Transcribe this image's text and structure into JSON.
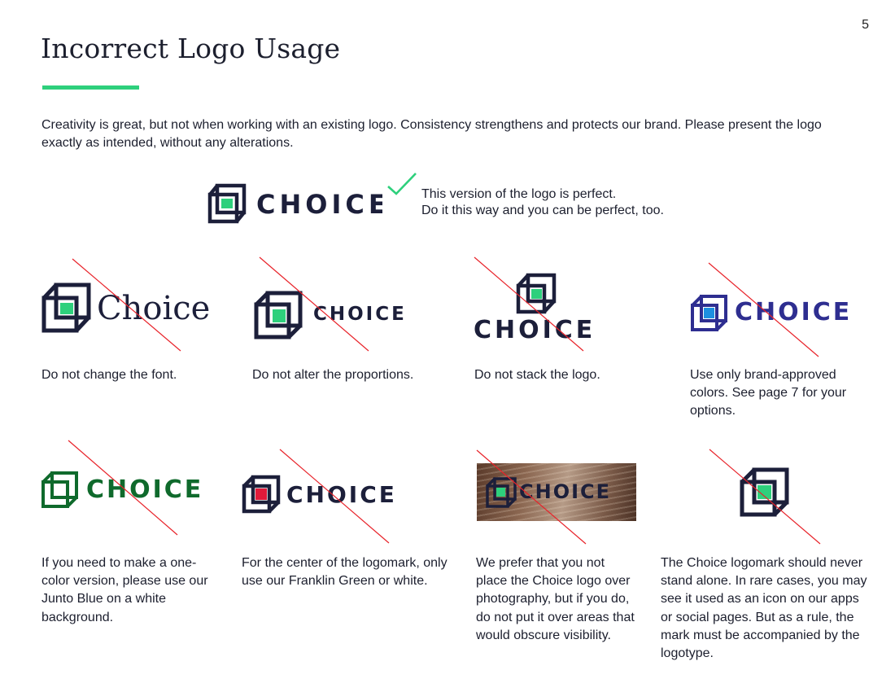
{
  "page": {
    "number": "5",
    "title": "Incorrect Logo Usage",
    "intro": "Creativity is great, but not when working with an existing logo. Consistency strengthens and protects our brand. Please present the logo exactly as intended, without any alterations."
  },
  "correct": {
    "wordmark": "CHOICE",
    "note_line1": "This version of the logo is perfect.",
    "note_line2": "Do it this way and you can be perfect, too."
  },
  "examples": [
    {
      "wordmark": "Choice",
      "caption": "Do not change the font."
    },
    {
      "wordmark": "CHOICE",
      "caption": "Do not alter the proportions."
    },
    {
      "wordmark": "CHOICE",
      "caption": "Do not stack the logo."
    },
    {
      "wordmark": "CHOICE",
      "caption": "Use only brand-approved colors. See page 7 for your options."
    },
    {
      "wordmark": "CHOICE",
      "caption": "If you need to make a one-color version, please use our Junto Blue on a white background."
    },
    {
      "wordmark": "CHOICE",
      "caption": "For the center of the logomark, only use our Franklin Green or white."
    },
    {
      "wordmark": "CHOICE",
      "caption": "We prefer that you not place the Choice logo over photography, but if you do, do not put it over areas that would obscure visibility."
    },
    {
      "wordmark": "",
      "caption": "The Choice logomark should never stand alone. In rare cases, you may see it used as an icon on our apps or social pages. But as a rule, the mark must be accompanied by the logotype."
    }
  ],
  "colors": {
    "navy": "#1c1f3a",
    "brand_green": "#2ed07c",
    "violet": "#2e2e90",
    "violet_center": "#1e90e0",
    "dark_green": "#0f6a2c",
    "red_center": "#e01a3a",
    "slash_red": "#e8232a"
  },
  "icons": {
    "approved_mark": "check-icon",
    "prohibited_mark": "red-slash-line",
    "logomark": "choice-cube-logomark"
  }
}
